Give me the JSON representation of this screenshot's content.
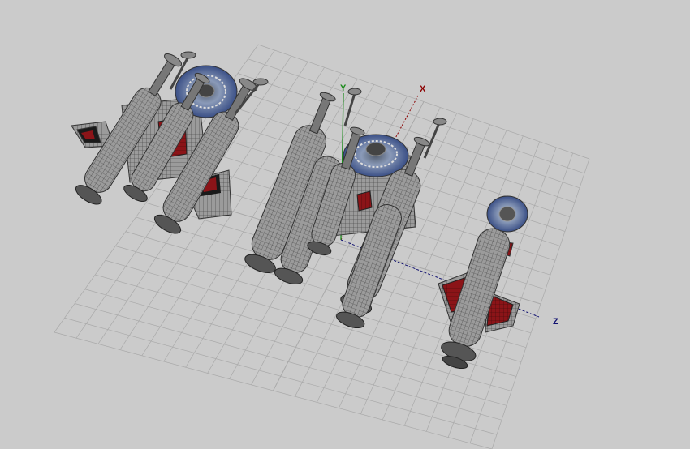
{
  "viewport": {
    "background": "#cbcbcb",
    "axes": {
      "x": {
        "label": "X",
        "color": "#8b0000"
      },
      "y": {
        "label": "Y",
        "color": "#1a8a1a"
      },
      "z": {
        "label": "Z",
        "color": "#101070"
      }
    }
  },
  "models": [
    {
      "id": "ship-left",
      "name": "spaceship-model-left"
    },
    {
      "id": "ship-center",
      "name": "spaceship-model-center"
    },
    {
      "id": "ship-right",
      "name": "spaceship-model-right"
    }
  ],
  "colors": {
    "hull": "#9a9a9a",
    "hull_dark": "#5e5e5e",
    "wire": "#2b2b2b",
    "accent_red": "#8b1418",
    "disc_blue": "#6f86ad",
    "grid": "#a9a9a9"
  }
}
